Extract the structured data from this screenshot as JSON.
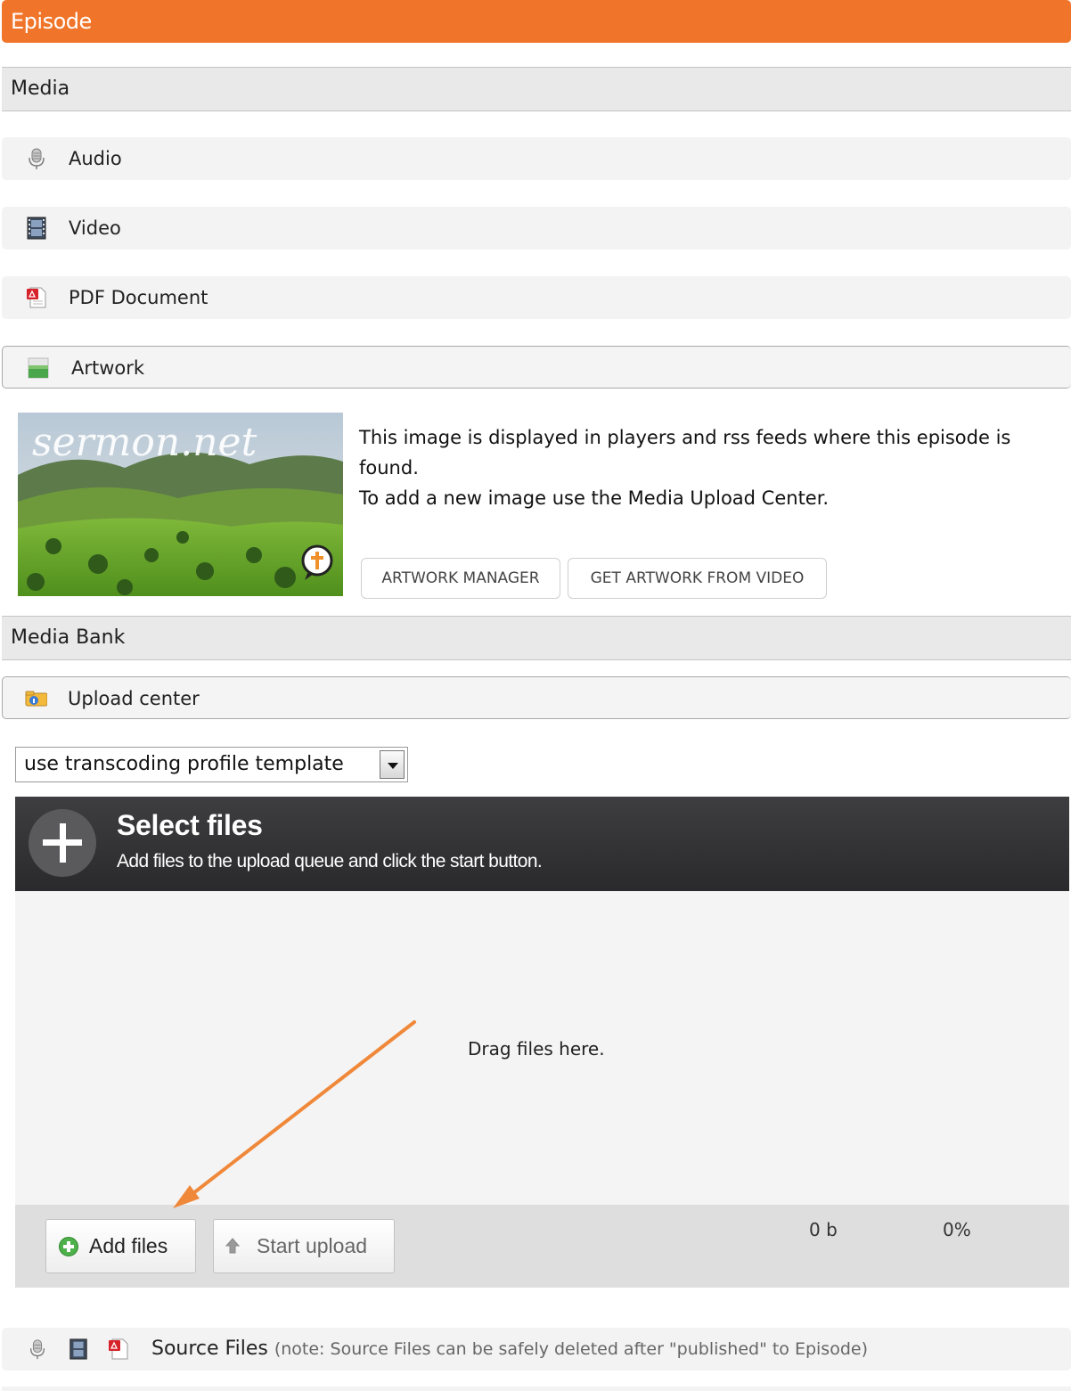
{
  "header": {
    "title": "Episode"
  },
  "media_section": {
    "title": "Media",
    "rows": [
      {
        "label": "Audio",
        "icon": "microphone-icon"
      },
      {
        "label": "Video",
        "icon": "film-icon"
      },
      {
        "label": "PDF Document",
        "icon": "pdf-icon"
      },
      {
        "label": "Artwork",
        "icon": "image-icon"
      }
    ]
  },
  "artwork": {
    "logo_text": "sermon.net",
    "description_line1": "This image is displayed in players and rss feeds where this episode is found.",
    "description_line2": "To add a new image use the Media Upload Center.",
    "artwork_manager_label": "ARTWORK MANAGER",
    "get_from_video_label": "GET ARTWORK FROM VIDEO"
  },
  "media_bank": {
    "title": "Media Bank",
    "upload_center_label": "Upload center"
  },
  "transcoding": {
    "selected": "use transcoding profile template"
  },
  "uploader": {
    "title": "Select files",
    "subtitle": "Add files to the upload queue and click the start button.",
    "drop_text": "Drag files here.",
    "add_files_label": "Add files",
    "start_upload_label": "Start upload",
    "total_size": "0 b",
    "percent": "0%"
  },
  "source_files": {
    "label": "Source Files",
    "note": "(note: Source Files can be safely deleted after \"published\" to Episode)"
  },
  "colors": {
    "accent": "#f0752a",
    "uploader_header": "#333335",
    "annotation_arrow": "#f0883a"
  }
}
